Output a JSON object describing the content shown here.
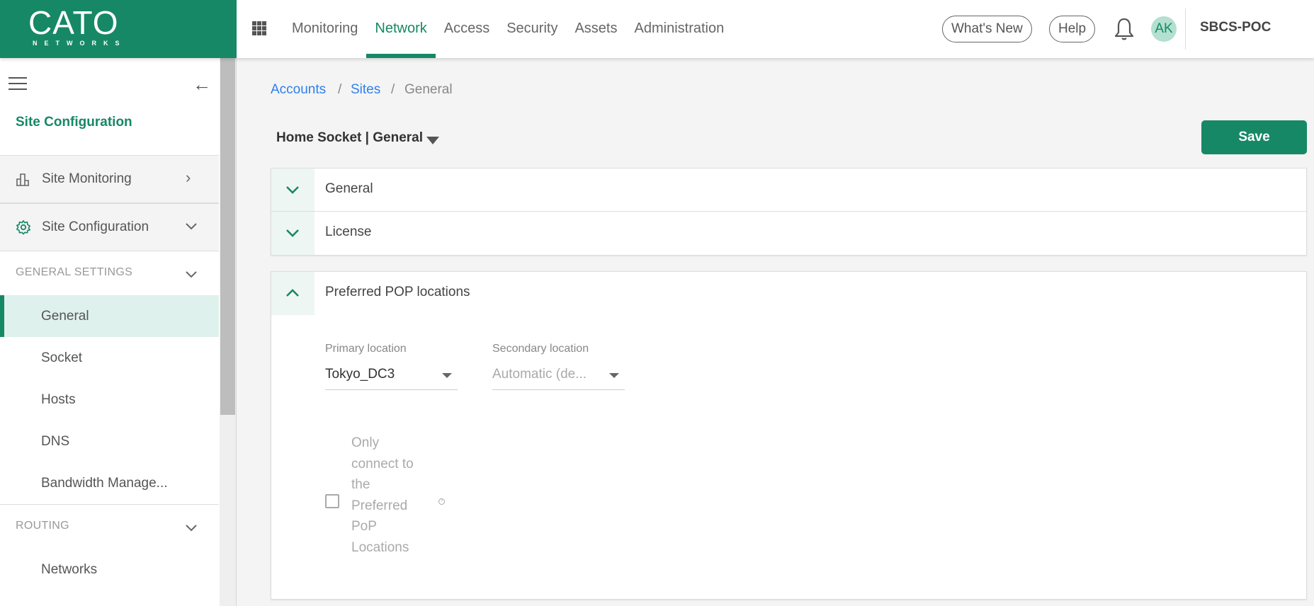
{
  "brand": {
    "name": "CATO",
    "sub": "NETWORKS",
    "color": "#178865"
  },
  "nav": {
    "apps_icon": "grid-icon",
    "items": [
      {
        "label": "Monitoring",
        "active": false
      },
      {
        "label": "Network",
        "active": true
      },
      {
        "label": "Access",
        "active": false
      },
      {
        "label": "Security",
        "active": false
      },
      {
        "label": "Assets",
        "active": false
      },
      {
        "label": "Administration",
        "active": false
      }
    ],
    "whats_new": "What's New",
    "help": "Help",
    "notifications_icon": "bell-icon",
    "avatar_initials": "AK",
    "account": "SBCS-POC"
  },
  "sidebar": {
    "menu_icon": "hamburger-icon",
    "collapse_icon": "arrow-left-icon",
    "title": "Site Configuration",
    "sections": [
      {
        "label": "Site Monitoring",
        "icon": "bar-chart-icon",
        "state": "collapsed"
      },
      {
        "label": "Site Configuration",
        "icon": "gear-icon",
        "state": "expanded"
      }
    ],
    "groups": [
      {
        "label": "GENERAL SETTINGS",
        "items": [
          "General",
          "Socket",
          "Hosts",
          "DNS",
          "Bandwidth Manage..."
        ],
        "active": "General"
      },
      {
        "label": "ROUTING",
        "items": [
          "Networks"
        ]
      }
    ]
  },
  "breadcrumb": [
    {
      "label": "Accounts",
      "link": true
    },
    {
      "label": "Sites",
      "link": true
    },
    {
      "label": "General",
      "link": false
    }
  ],
  "page": {
    "title": "Home Socket | General",
    "save_label": "Save"
  },
  "panels": {
    "collapsed": [
      "General",
      "License"
    ],
    "pop": {
      "title": "Preferred POP locations",
      "primary_label": "Primary location",
      "primary_value": "Tokyo_DC3",
      "secondary_label": "Secondary location",
      "secondary_placeholder": "Automatic (de...",
      "checkbox_label": "Only connect to the Preferred PoP Locations",
      "checkbox_checked": false
    }
  }
}
